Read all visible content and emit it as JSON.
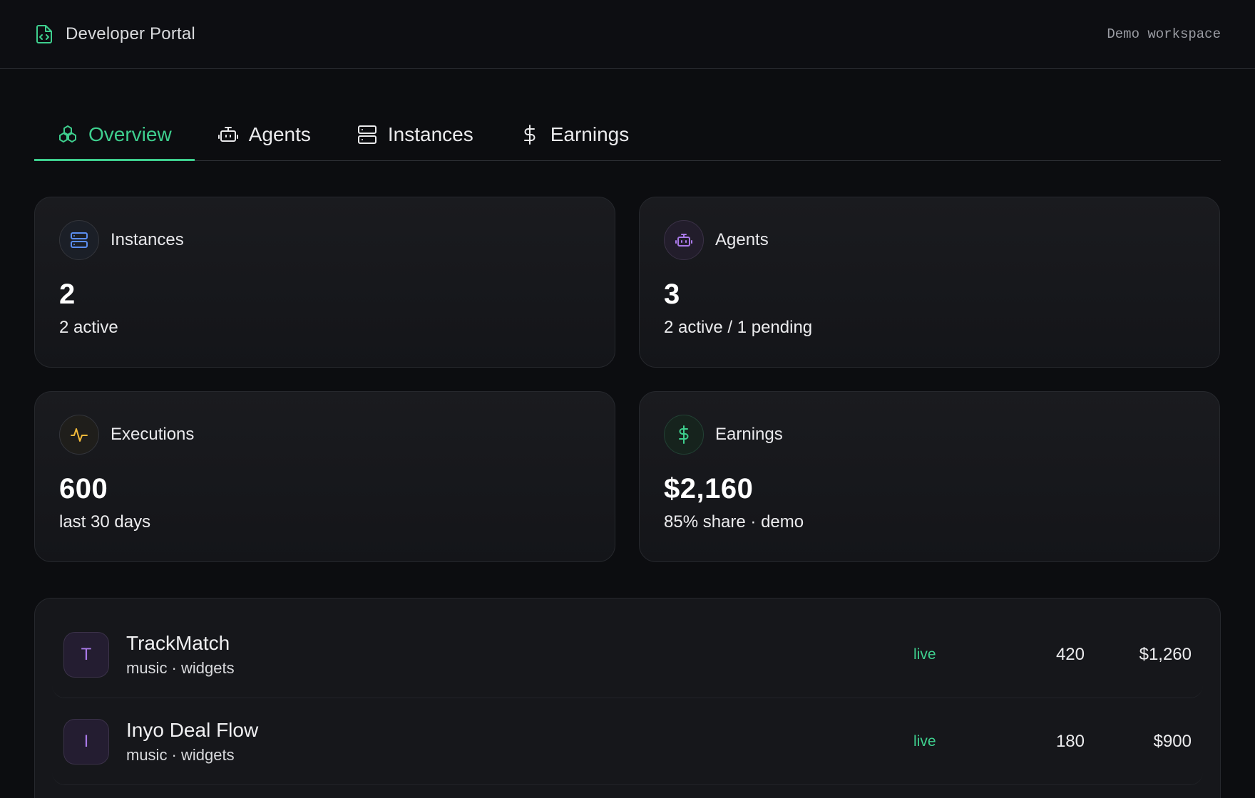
{
  "header": {
    "title": "Developer Portal",
    "workspace": "Demo workspace"
  },
  "tabs": [
    {
      "label": "Overview",
      "icon": "cubes-icon",
      "active": true
    },
    {
      "label": "Agents",
      "icon": "robot-icon",
      "active": false
    },
    {
      "label": "Instances",
      "icon": "server-icon",
      "active": false
    },
    {
      "label": "Earnings",
      "icon": "dollar-icon",
      "active": false
    }
  ],
  "stats": {
    "instances": {
      "label": "Instances",
      "value": "2",
      "sub": "2 active",
      "icon": "server-icon"
    },
    "agents": {
      "label": "Agents",
      "value": "3",
      "sub": "2 active / 1 pending",
      "icon": "robot-icon"
    },
    "executions": {
      "label": "Executions",
      "value": "600",
      "sub": "last 30 days",
      "icon": "activity-icon"
    },
    "earnings": {
      "label": "Earnings",
      "value": "$2,160",
      "sub": "85% share · demo",
      "icon": "dollar-icon"
    }
  },
  "agents_list": [
    {
      "initial": "T",
      "name": "TrackMatch",
      "tags": "music · widgets",
      "status": "live",
      "executions": "420",
      "earnings": "$1,260"
    },
    {
      "initial": "I",
      "name": "Inyo Deal Flow",
      "tags": "music · widgets",
      "status": "live",
      "executions": "180",
      "earnings": "$900"
    }
  ],
  "colors": {
    "accent": "#3ecf8e",
    "background": "#0c0d10",
    "blue": "#5b8def",
    "purple": "#a979e8",
    "yellow": "#f1b93a"
  }
}
